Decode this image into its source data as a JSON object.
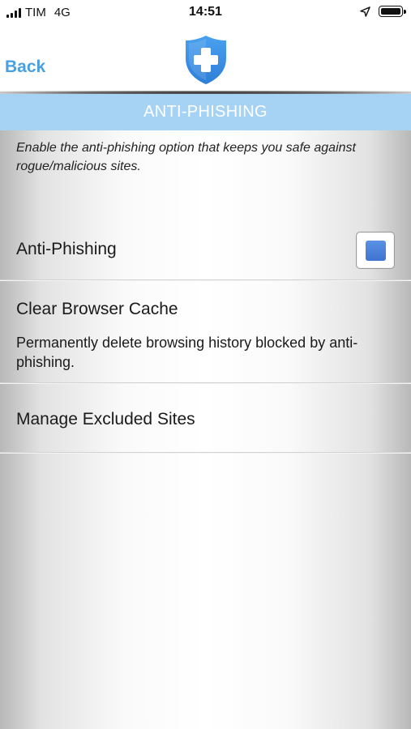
{
  "status_bar": {
    "carrier": "TIM",
    "network": "4G",
    "time": "14:51",
    "icons": [
      "signal-icon",
      "location-arrow-icon",
      "battery-icon"
    ]
  },
  "nav": {
    "back_label": "Back",
    "logo_icon": "shield-cross-icon"
  },
  "page": {
    "title": "ANTI-PHISHING",
    "description": "Enable the anti-phishing option that keeps you safe against rogue/malicious sites."
  },
  "settings": {
    "anti_phishing": {
      "label": "Anti-Phishing",
      "enabled": true
    },
    "clear_cache": {
      "label": "Clear Browser Cache",
      "description": "Permanently delete browsing history blocked by anti-phishing."
    },
    "excluded_sites": {
      "label": "Manage Excluded Sites"
    }
  },
  "colors": {
    "accent": "#4a9fe0",
    "title_bar": "#a6d3f3",
    "shield": "#3b8fe6",
    "checkbox_fill": "#4a80da"
  }
}
